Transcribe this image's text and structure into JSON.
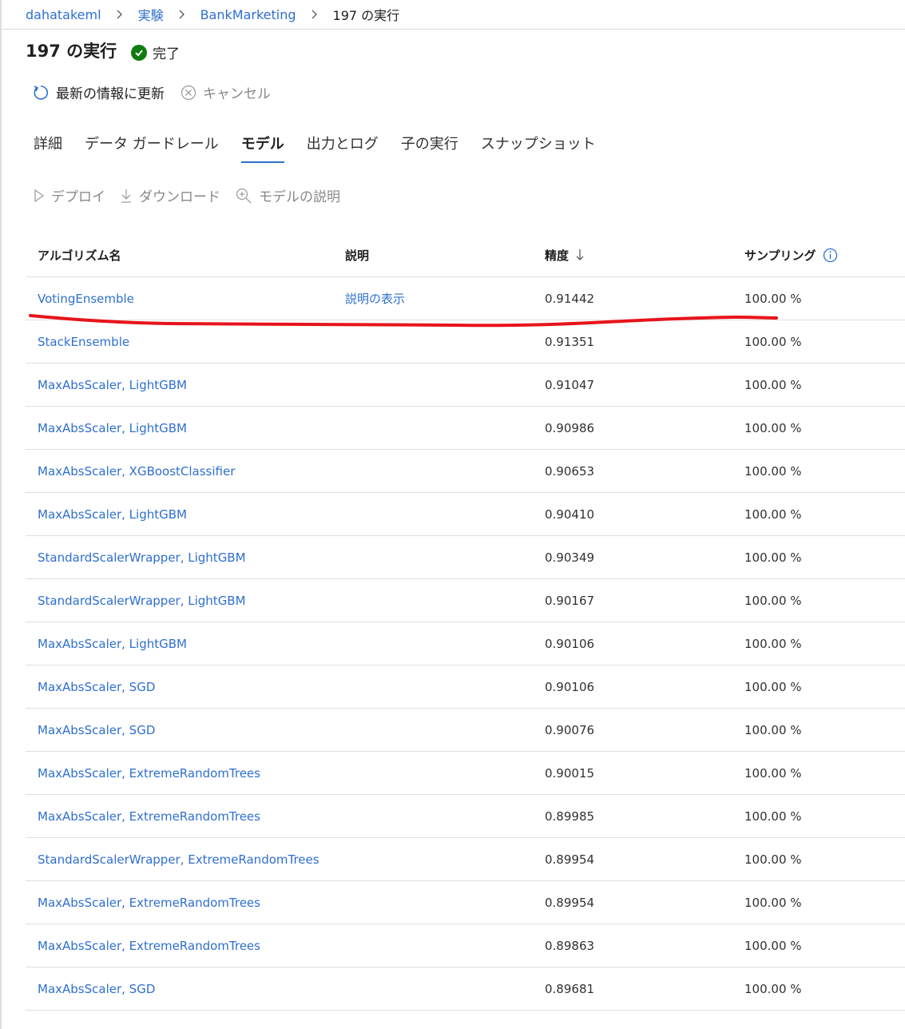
{
  "breadcrumb": {
    "items": [
      "dahatakeml",
      "実験",
      "BankMarketing"
    ],
    "current": "197 の実行"
  },
  "header": {
    "title": "197 の実行",
    "status": "完了"
  },
  "commands": {
    "refresh": "最新の情報に更新",
    "cancel": "キャンセル"
  },
  "tabs": [
    "詳細",
    "データ ガードレール",
    "モデル",
    "出力とログ",
    "子の実行",
    "スナップショット"
  ],
  "active_tab": "モデル",
  "model_commands": {
    "deploy": "デプロイ",
    "download": "ダウンロード",
    "explain": "モデルの説明"
  },
  "table": {
    "headers": {
      "algorithm": "アルゴリズム名",
      "description": "説明",
      "accuracy": "精度",
      "sampling": "サンプリング"
    },
    "rows": [
      {
        "algorithm": "VotingEnsemble",
        "description": "説明の表示",
        "accuracy": "0.91442",
        "sampling": "100.00 %"
      },
      {
        "algorithm": "StackEnsemble",
        "description": "",
        "accuracy": "0.91351",
        "sampling": "100.00 %"
      },
      {
        "algorithm": "MaxAbsScaler, LightGBM",
        "description": "",
        "accuracy": "0.91047",
        "sampling": "100.00 %"
      },
      {
        "algorithm": "MaxAbsScaler, LightGBM",
        "description": "",
        "accuracy": "0.90986",
        "sampling": "100.00 %"
      },
      {
        "algorithm": "MaxAbsScaler, XGBoostClassifier",
        "description": "",
        "accuracy": "0.90653",
        "sampling": "100.00 %"
      },
      {
        "algorithm": "MaxAbsScaler, LightGBM",
        "description": "",
        "accuracy": "0.90410",
        "sampling": "100.00 %"
      },
      {
        "algorithm": "StandardScalerWrapper, LightGBM",
        "description": "",
        "accuracy": "0.90349",
        "sampling": "100.00 %"
      },
      {
        "algorithm": "StandardScalerWrapper, LightGBM",
        "description": "",
        "accuracy": "0.90167",
        "sampling": "100.00 %"
      },
      {
        "algorithm": "MaxAbsScaler, LightGBM",
        "description": "",
        "accuracy": "0.90106",
        "sampling": "100.00 %"
      },
      {
        "algorithm": "MaxAbsScaler, SGD",
        "description": "",
        "accuracy": "0.90106",
        "sampling": "100.00 %"
      },
      {
        "algorithm": "MaxAbsScaler, SGD",
        "description": "",
        "accuracy": "0.90076",
        "sampling": "100.00 %"
      },
      {
        "algorithm": "MaxAbsScaler, ExtremeRandomTrees",
        "description": "",
        "accuracy": "0.90015",
        "sampling": "100.00 %"
      },
      {
        "algorithm": "MaxAbsScaler, ExtremeRandomTrees",
        "description": "",
        "accuracy": "0.89985",
        "sampling": "100.00 %"
      },
      {
        "algorithm": "StandardScalerWrapper, ExtremeRandomTrees",
        "description": "",
        "accuracy": "0.89954",
        "sampling": "100.00 %"
      },
      {
        "algorithm": "MaxAbsScaler, ExtremeRandomTrees",
        "description": "",
        "accuracy": "0.89954",
        "sampling": "100.00 %"
      },
      {
        "algorithm": "MaxAbsScaler, ExtremeRandomTrees",
        "description": "",
        "accuracy": "0.89863",
        "sampling": "100.00 %"
      },
      {
        "algorithm": "MaxAbsScaler, SGD",
        "description": "",
        "accuracy": "0.89681",
        "sampling": "100.00 %"
      }
    ]
  },
  "colors": {
    "link": "#2f6fce",
    "success": "#107c10",
    "annotation": "#e8141c"
  }
}
